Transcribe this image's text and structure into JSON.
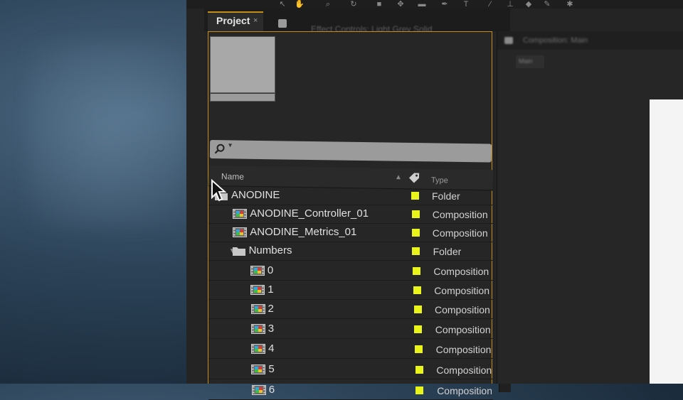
{
  "toolbar": {
    "tools": [
      {
        "icon": "arrow-tool-icon",
        "glyph": "↖"
      },
      {
        "icon": "hand-tool-icon",
        "glyph": "✋"
      },
      {
        "icon": "zoom-tool-icon",
        "glyph": "⌕"
      },
      {
        "icon": "rotate-tool-icon",
        "glyph": "↻"
      },
      {
        "icon": "camera-tool-icon",
        "glyph": "■"
      },
      {
        "icon": "pan-behind-tool-icon",
        "glyph": "✥"
      },
      {
        "icon": "rectangle-tool-icon",
        "glyph": "▬"
      },
      {
        "icon": "pen-tool-icon",
        "glyph": "✒"
      },
      {
        "icon": "type-tool-icon",
        "glyph": "T"
      },
      {
        "icon": "brush-tool-icon",
        "glyph": "∕"
      },
      {
        "icon": "clone-stamp-tool-icon",
        "glyph": "⊥"
      },
      {
        "icon": "eraser-tool-icon",
        "glyph": "◆"
      },
      {
        "icon": "roto-brush-tool-icon",
        "glyph": "✎"
      },
      {
        "icon": "puppet-pin-tool-icon",
        "glyph": "✱"
      }
    ]
  },
  "project_panel": {
    "tab_label": "Project",
    "tab_close": "×",
    "effect_controls_tab": "Effect Controls: Light Grey Solid",
    "columns": {
      "name": "Name",
      "sort_glyph": "▲",
      "type": "Type"
    },
    "items": [
      {
        "name": "ANODINE",
        "type": "Folder",
        "kind": "folder",
        "expanded": true,
        "depth": 0
      },
      {
        "name": "ANODINE_Controller_01",
        "type": "Composition",
        "kind": "comp",
        "depth": 1
      },
      {
        "name": "ANODINE_Metrics_01",
        "type": "Composition",
        "kind": "comp",
        "depth": 1
      },
      {
        "name": "Numbers",
        "type": "Folder",
        "kind": "folder",
        "expanded": true,
        "depth": 1
      },
      {
        "name": "0",
        "type": "Composition",
        "kind": "comp",
        "depth": 2
      },
      {
        "name": "1",
        "type": "Composition",
        "kind": "comp",
        "depth": 2
      },
      {
        "name": "2",
        "type": "Composition",
        "kind": "comp",
        "depth": 2
      },
      {
        "name": "3",
        "type": "Composition",
        "kind": "comp",
        "depth": 2
      },
      {
        "name": "4",
        "type": "Composition",
        "kind": "comp",
        "depth": 2
      },
      {
        "name": "5",
        "type": "Composition",
        "kind": "comp",
        "depth": 2
      },
      {
        "name": "6",
        "type": "Composition",
        "kind": "comp",
        "depth": 2
      }
    ],
    "label_color": "#e9f51a"
  },
  "comp_panel": {
    "tab_label": "Composition: Main",
    "sub_tab": "Main"
  },
  "colors": {
    "accent": "#c38d16",
    "label_yellow": "#e9f51a",
    "panel_bg": "#262626"
  }
}
